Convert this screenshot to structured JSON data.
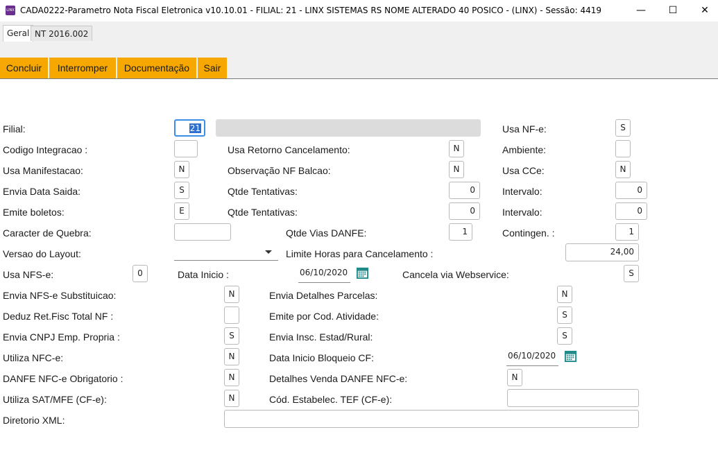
{
  "window": {
    "icon_text": "LINX",
    "title": "CADA0222-Parametro Nota Fiscal Eletronica v10.10.01   - FILIAL: 21 - LINX SISTEMAS RS NOME ALTERADO 40 POSICO - (LINX) - Sessão: 4419",
    "minimize": "—",
    "maximize": "☐",
    "close": "✕"
  },
  "tabs": [
    {
      "label": "Geral",
      "active": true
    },
    {
      "label": "NT 2016.002",
      "active": false
    }
  ],
  "toolbar": {
    "color": "#f6a800",
    "buttons": [
      "Concluir",
      "Interromper",
      "Documentação",
      "Sair"
    ]
  },
  "form": {
    "filial": {
      "label": "Filial:",
      "value": "21"
    },
    "filial_nome": {
      "value": ""
    },
    "usa_nfe": {
      "label": "Usa NF-e:",
      "value": "S"
    },
    "codigo_integracao": {
      "label": "Codigo Integracao :",
      "value": ""
    },
    "usa_retorno_cancelamento": {
      "label": "Usa Retorno Cancelamento:",
      "value": "N"
    },
    "ambiente": {
      "label": "Ambiente:",
      "value": ""
    },
    "usa_manifestacao": {
      "label": "Usa Manifestacao:",
      "value": "N"
    },
    "observacao_nf_balcao": {
      "label": "Observação NF Balcao:",
      "value": "N"
    },
    "usa_cce": {
      "label": "Usa CCe:",
      "value": "N"
    },
    "envia_data_saida": {
      "label": "Envia Data Saida:",
      "value": "S"
    },
    "qtde_tentativas_1": {
      "label": "Qtde Tentativas:",
      "value": "0"
    },
    "intervalo_1": {
      "label": "Intervalo:",
      "value": "0"
    },
    "emite_boletos": {
      "label": "Emite boletos:",
      "value": "E"
    },
    "qtde_tentativas_2": {
      "label": "Qtde Tentativas:",
      "value": "0"
    },
    "intervalo_2": {
      "label": "Intervalo:",
      "value": "0"
    },
    "caracter_quebra": {
      "label": "Caracter de Quebra:",
      "value": ""
    },
    "qtde_vias_danfe": {
      "label": "Qtde Vias DANFE:",
      "value": "1"
    },
    "contingen": {
      "label": "Contingen. :",
      "value": "1"
    },
    "versao_layout": {
      "label": "Versao do Layout:",
      "value": ""
    },
    "limite_horas": {
      "label": "Limite Horas para Cancelamento :",
      "value": "24,00"
    },
    "usa_nfse": {
      "label": "Usa NFS-e:",
      "value": "0"
    },
    "data_inicio": {
      "label": "Data Inicio :",
      "value": "06/10/2020"
    },
    "cancela_webservice": {
      "label": "Cancela via Webservice:",
      "value": "S"
    },
    "envia_nfse_subst": {
      "label": "Envia NFS-e Substituicao:",
      "value": "N"
    },
    "envia_detalhes_parcelas": {
      "label": "Envia Detalhes Parcelas:",
      "value": "N"
    },
    "deduz_ret_fisc": {
      "label": "Deduz Ret.Fisc Total NF :",
      "value": ""
    },
    "emite_cod_atividade": {
      "label": "Emite por Cod. Atividade:",
      "value": "S"
    },
    "envia_cnpj_emp": {
      "label": "Envia CNPJ Emp. Propria :",
      "value": "S"
    },
    "envia_insc_estad": {
      "label": "Envia Insc. Estad/Rural:",
      "value": "S"
    },
    "utiliza_nfce": {
      "label": "Utiliza NFC-e:",
      "value": "N"
    },
    "data_inicio_bloqueio": {
      "label": "Data Inicio Bloqueio CF:",
      "value": "06/10/2020"
    },
    "danfe_nfce_obrig": {
      "label": "DANFE NFC-e Obrigatorio :",
      "value": "N"
    },
    "detalhes_venda_danfe": {
      "label": "Detalhes Venda DANFE NFC-e:",
      "value": "N"
    },
    "utiliza_sat": {
      "label": "Utiliza SAT/MFE (CF-e):",
      "value": "N"
    },
    "cod_estabelec_tef": {
      "label": "Cód. Estabelec. TEF (CF-e):",
      "value": ""
    },
    "diretorio_xml": {
      "label": "Diretorio XML:",
      "value": ""
    }
  }
}
